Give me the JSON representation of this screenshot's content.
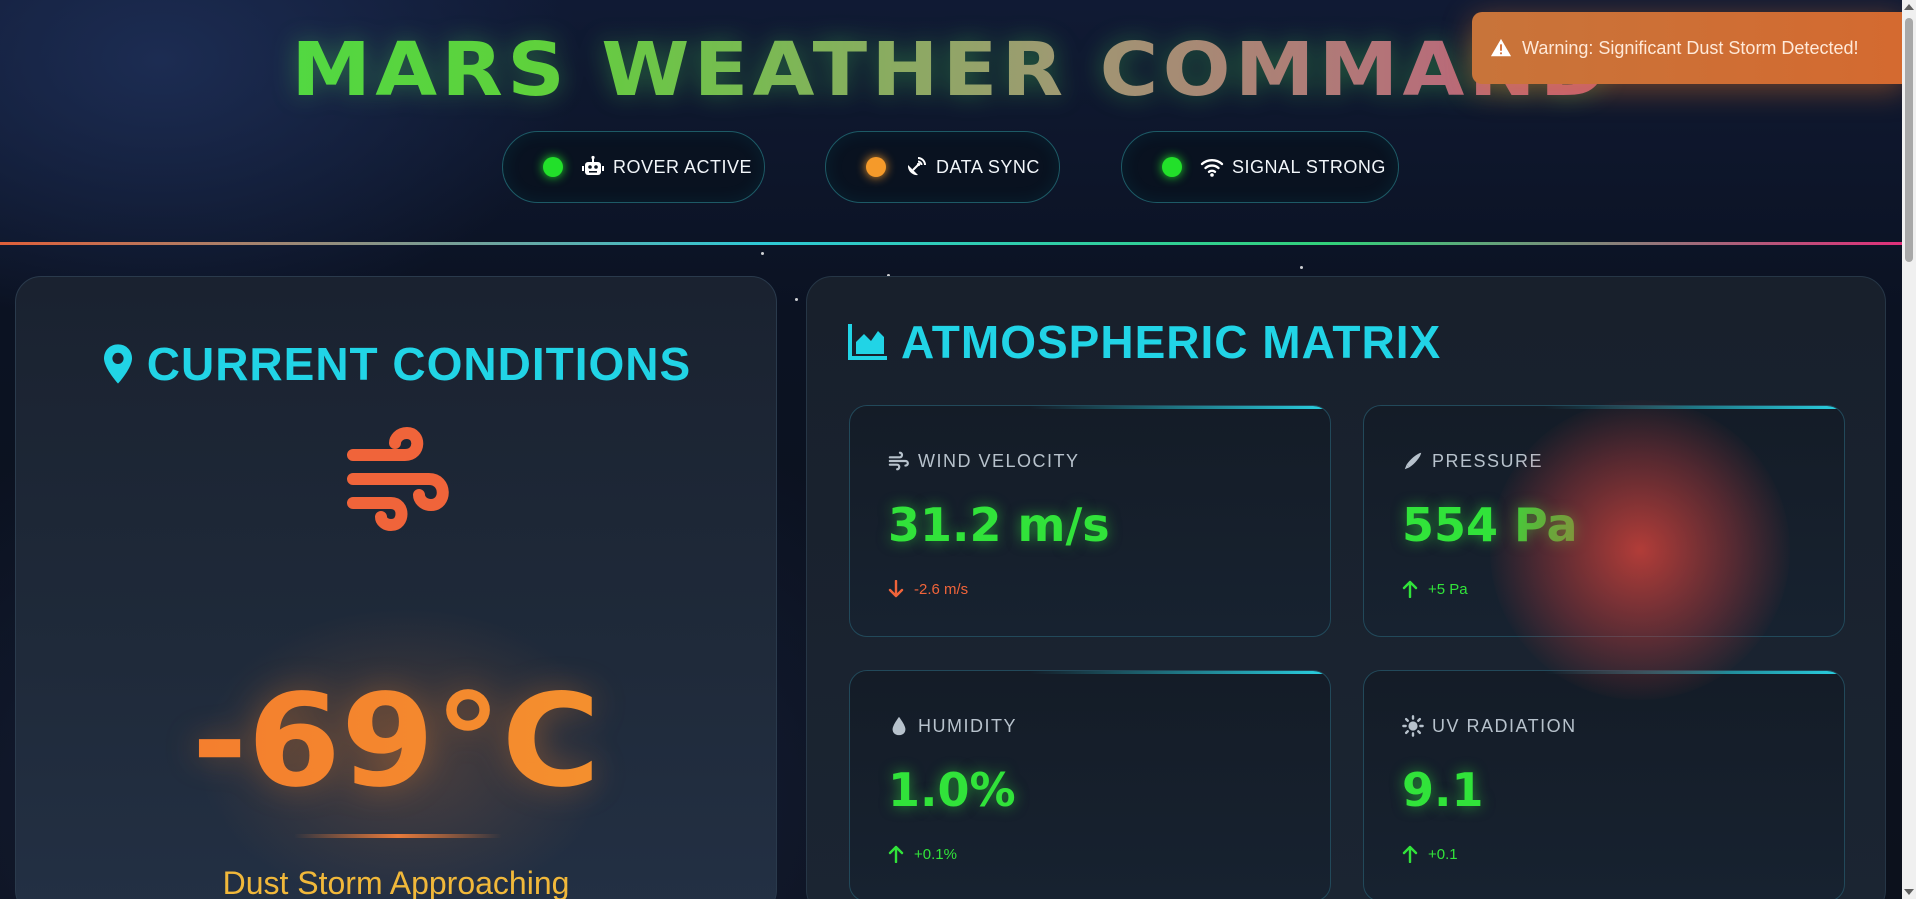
{
  "header": {
    "title": "MARS WEATHER COMMAND",
    "status": [
      {
        "label": "ROVER ACTIVE",
        "dot_color": "#22e02a",
        "icon": "robot-icon"
      },
      {
        "label": "DATA SYNC",
        "dot_color": "#f59a2a",
        "icon": "satellite-dish-icon"
      },
      {
        "label": "SIGNAL STRONG",
        "dot_color": "#22e02a",
        "icon": "wifi-icon"
      }
    ]
  },
  "toast": {
    "message": "Warning: Significant Dust Storm Detected!",
    "icon": "warning-icon"
  },
  "current": {
    "title": "CURRENT CONDITIONS",
    "icon": "location-pin-icon",
    "weather_icon": "wind-icon",
    "temperature": "-69°C",
    "condition": "Dust Storm Approaching"
  },
  "atmosphere": {
    "title": "ATMOSPHERIC MATRIX",
    "icon": "area-chart-icon",
    "metrics": [
      {
        "label": "WIND VELOCITY",
        "value": "31.2 m/s",
        "delta": "-2.6 m/s",
        "trend": "down",
        "icon": "wind-icon"
      },
      {
        "label": "PRESSURE",
        "value": "554 Pa",
        "delta": "+5 Pa",
        "trend": "up",
        "icon": "gauge-needle-icon"
      },
      {
        "label": "HUMIDITY",
        "value": "1.0%",
        "delta": "+0.1%",
        "trend": "up",
        "icon": "droplet-icon"
      },
      {
        "label": "UV RADIATION",
        "value": "9.1",
        "delta": "+0.1",
        "trend": "up",
        "icon": "sun-icon"
      }
    ]
  },
  "colors": {
    "accent_cyan": "#21d4e6",
    "value_green": "#31e33a",
    "temp_orange": "#f28a30",
    "warning_orange": "#d46a30"
  }
}
